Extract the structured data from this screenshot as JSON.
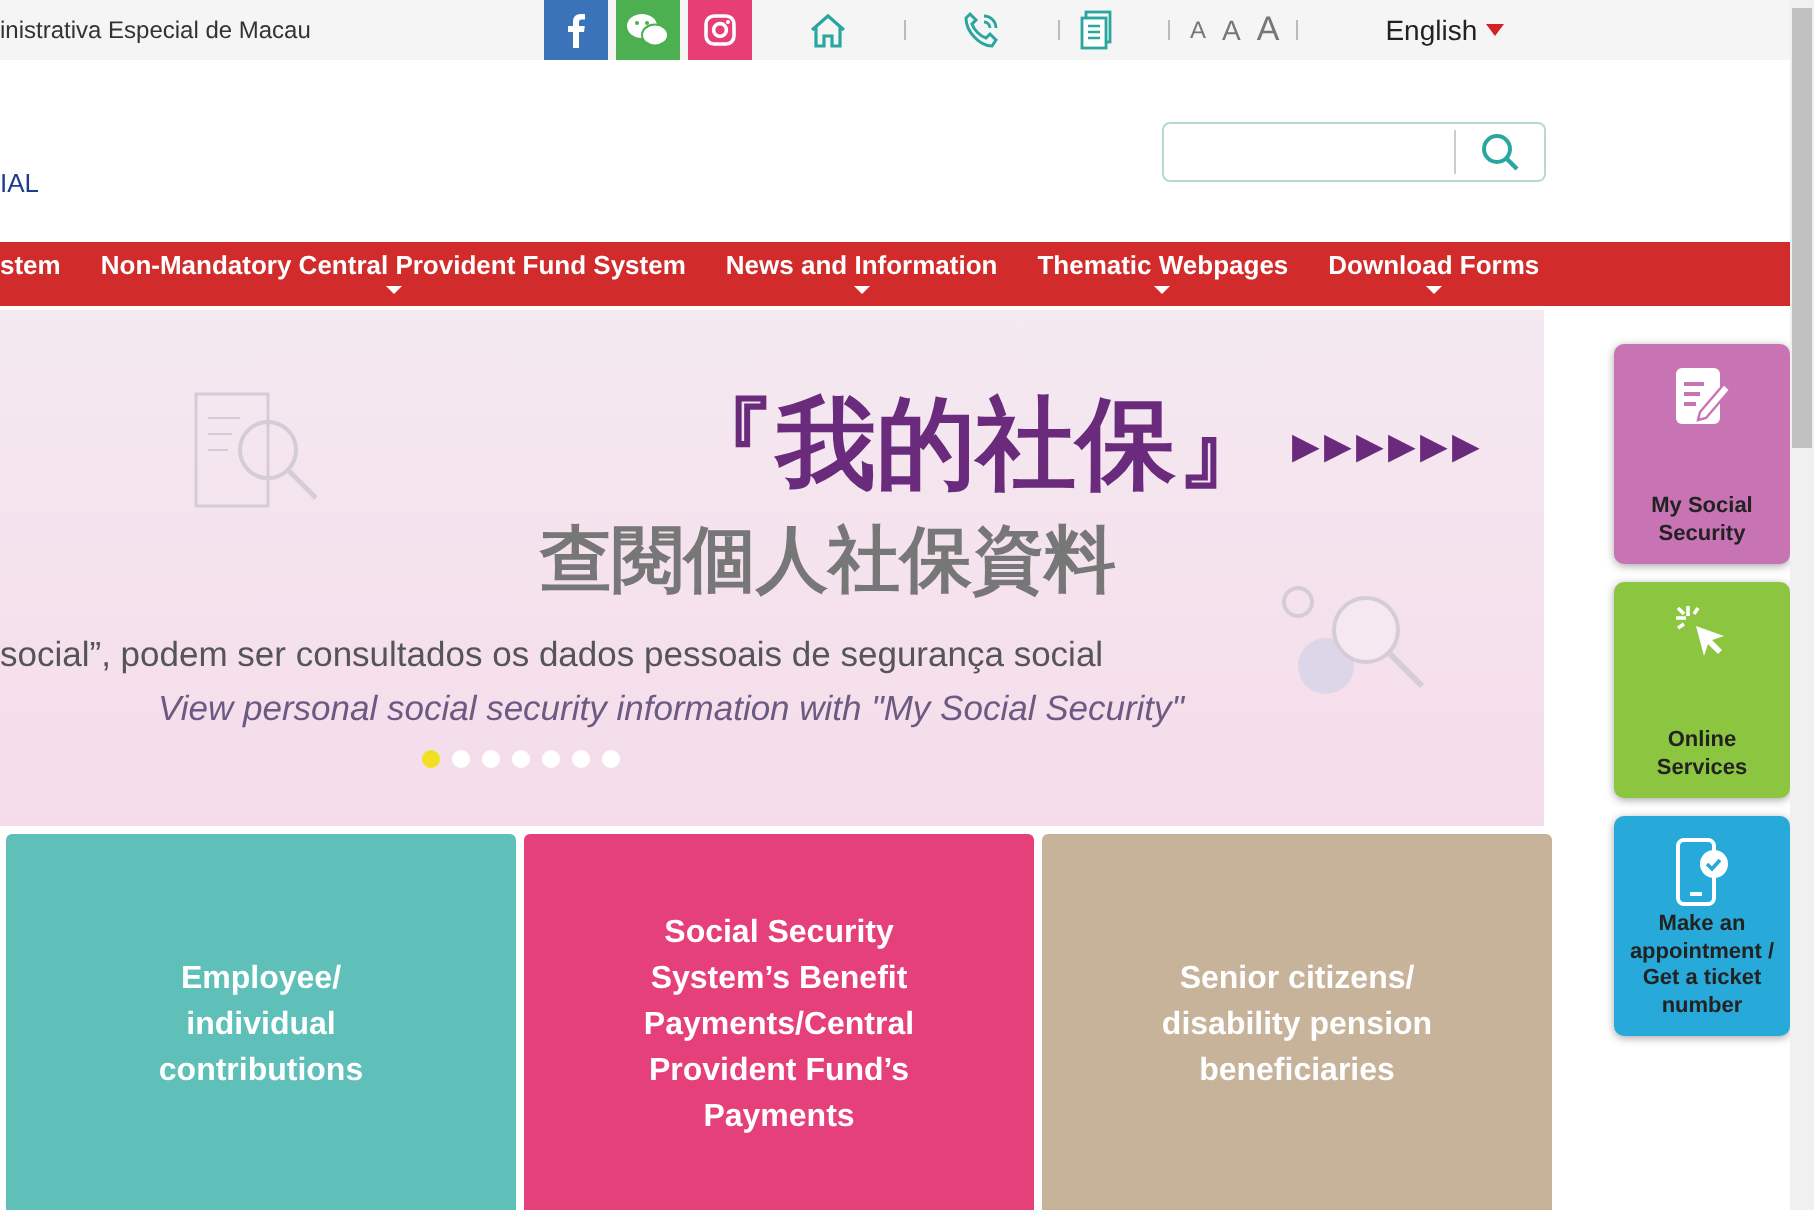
{
  "top_bar": {
    "org_name": "inistrativa Especial de Macau",
    "font_sizes": [
      "A",
      "A",
      "A"
    ],
    "language": "English"
  },
  "header": {
    "logo_text": "IAL"
  },
  "nav": [
    {
      "label": "stem",
      "has_submenu": false
    },
    {
      "label": "Non-Mandatory Central Provident Fund System",
      "has_submenu": true
    },
    {
      "label": "News and Information",
      "has_submenu": true
    },
    {
      "label": "Thematic Webpages",
      "has_submenu": true
    },
    {
      "label": "Download Forms",
      "has_submenu": true
    }
  ],
  "banner": {
    "title": "『我的社保』",
    "arrows": "▶▶▶▶▶▶",
    "subtitle": "查閱個人社保資料",
    "line_pt": "social”, podem ser consultados os dados pessoais de segurança social",
    "line_en": "View personal social security information with \"My Social Security\"",
    "dots": [
      {
        "selected": true
      },
      {
        "selected": false
      },
      {
        "selected": false
      },
      {
        "selected": false
      },
      {
        "selected": false
      },
      {
        "selected": false
      },
      {
        "selected": false
      }
    ]
  },
  "tiles": [
    {
      "label": "Employee/ individual contributions",
      "color": "#5fbfb9"
    },
    {
      "label": "Social Security System’s Benefit Payments/Central Provident Fund’s Payments",
      "color": "#e5407a"
    },
    {
      "label": "Senior citizens/ disability pension beneficiaries",
      "color": "#c7b29a"
    }
  ],
  "quick_links": [
    {
      "kind": "form",
      "label": "My Social Security",
      "color": "#c873b3"
    },
    {
      "kind": "click",
      "label": "Online Services",
      "color": "#8cc53f"
    },
    {
      "kind": "phone",
      "label": "Make an appointment / Get a ticket number",
      "color": "#27a9d9"
    }
  ]
}
